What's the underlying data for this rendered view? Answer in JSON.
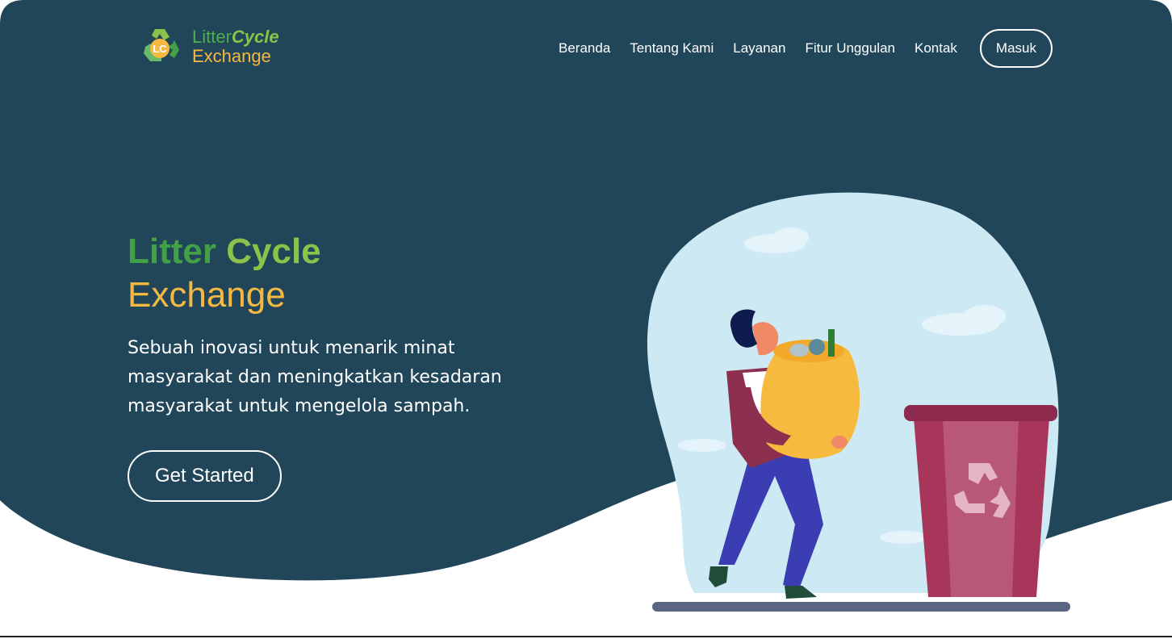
{
  "brand": {
    "name_part1": "Litter",
    "name_part2": "Cycle",
    "name_line2": "Exchange",
    "logo_monogram": "LC"
  },
  "nav": {
    "items": [
      {
        "label": "Beranda"
      },
      {
        "label": "Tentang Kami"
      },
      {
        "label": "Layanan"
      },
      {
        "label": "Fitur Unggulan"
      },
      {
        "label": "Kontak"
      }
    ],
    "login_label": "Masuk"
  },
  "hero": {
    "title_word1": "Litter",
    "title_word2": "Cycle",
    "title_line2": "Exchange",
    "description": "Sebuah inovasi untuk menarik minat masyarakat dan meningkatkan kesadaran masyarakat untuk mengelola sampah.",
    "cta_label": "Get Started"
  },
  "colors": {
    "hero_background": "#214659",
    "green": "#43a047",
    "light_green": "#8bc34a",
    "yellow": "#f5b942",
    "bin": "#a8365b"
  },
  "icons": {
    "logo": "recycle-logo-icon",
    "bin_symbol": "recycle-icon"
  }
}
